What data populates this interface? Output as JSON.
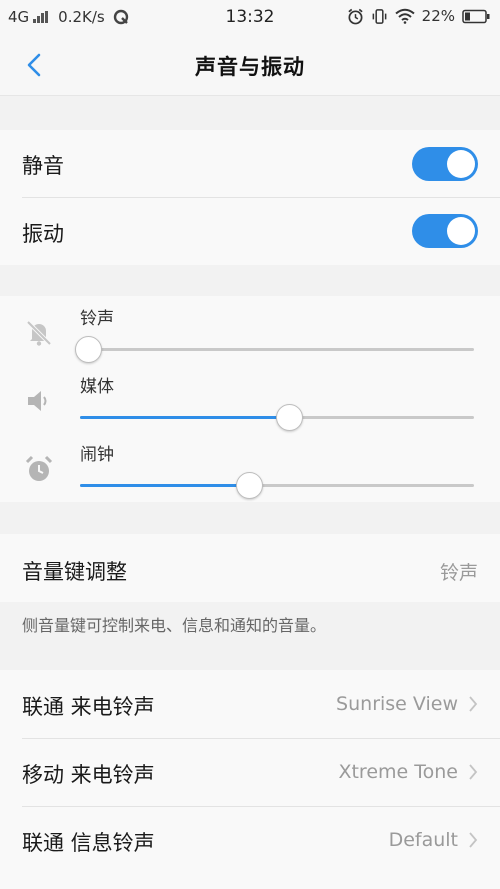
{
  "status_bar": {
    "network": "4G",
    "speed": "0.2K/s",
    "time": "13:32",
    "battery": "22%",
    "icons": [
      "signal-icon",
      "notification-icon",
      "alarm-icon",
      "vibrate-icon",
      "wifi-icon",
      "battery-icon"
    ]
  },
  "header": {
    "title": "声音与振动",
    "back_icon": "chevron-left-icon"
  },
  "toggles": [
    {
      "label": "静音",
      "on": true
    },
    {
      "label": "振动",
      "on": true
    }
  ],
  "volumes": [
    {
      "label": "铃声",
      "icon": "bell-muted-icon",
      "level": 0.02
    },
    {
      "label": "媒体",
      "icon": "speaker-icon",
      "level": 0.53
    },
    {
      "label": "闹钟",
      "icon": "alarm-clock-icon",
      "level": 0.43
    }
  ],
  "volume_key": {
    "label": "音量键调整",
    "value": "铃声",
    "note": "侧音量键可控制来电、信息和通知的音量。"
  },
  "ringtones": [
    {
      "label": "联通 来电铃声",
      "value": "Sunrise View"
    },
    {
      "label": "移动 来电铃声",
      "value": "Xtreme Tone"
    },
    {
      "label": "联通 信息铃声",
      "value": "Default"
    }
  ],
  "colors": {
    "accent": "#2f8ee8",
    "background": "#f2f2f2",
    "card": "#f9f9f9"
  }
}
